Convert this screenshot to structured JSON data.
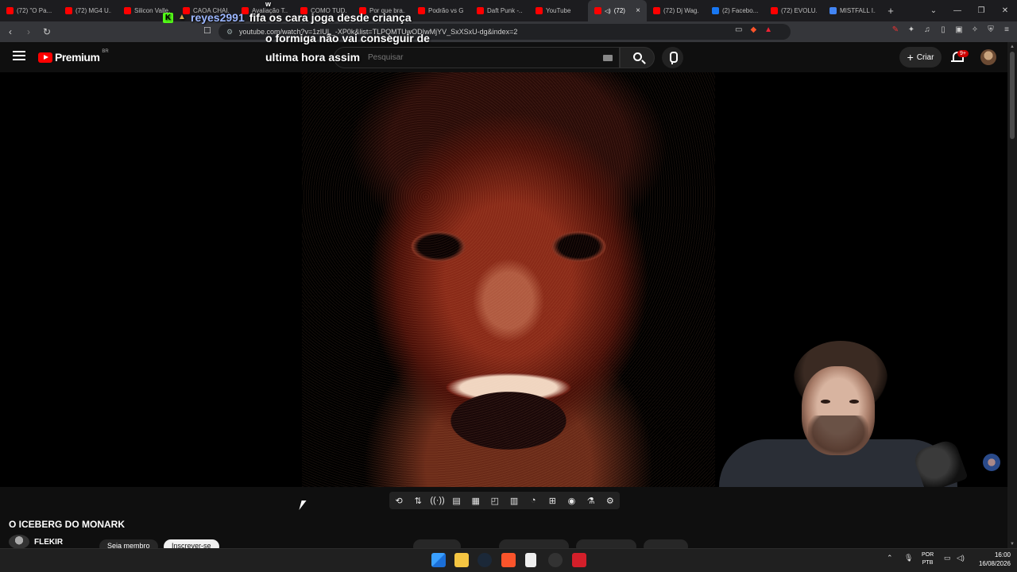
{
  "browser": {
    "tabs": [
      {
        "label": "(72) \"O Pa...",
        "color": "#ff0000"
      },
      {
        "label": "(72) MG4 U...",
        "color": "#ff0000"
      },
      {
        "label": "Silicon Valle...",
        "color": "#ff0000"
      },
      {
        "label": "CAOA CHAI...",
        "color": "#ff0000"
      },
      {
        "label": "Avaliação T...",
        "color": "#ff0000"
      },
      {
        "label": "COMO TUD...",
        "color": "#ff0000"
      },
      {
        "label": "Por que bra...",
        "color": "#ff0000"
      },
      {
        "label": "Podrão vs G...",
        "color": "#ff0000"
      },
      {
        "label": "Daft Punk -...",
        "color": "#ff0000"
      },
      {
        "label": "YouTube",
        "color": "#ff0000"
      },
      {
        "label": "(72)",
        "color": "#ff0000",
        "active": true
      },
      {
        "label": "(72) Dj Wag...",
        "color": "#ff0000"
      },
      {
        "label": "(2) Facebo...",
        "color": "#1877f2"
      },
      {
        "label": "(72) EVOLU...",
        "color": "#ff0000"
      },
      {
        "label": "MISTFALL I...",
        "color": "#4285f4"
      }
    ],
    "new_tab": "+",
    "url": "youtube.com/watch?v=1zIUL_-XP0k&list=TLPQMTUwODIwMjYV_SxXSxU-dg&index=2"
  },
  "youtube": {
    "logo_word": "Premium",
    "logo_country": "BR",
    "search_placeholder": "Pesquisar",
    "create_label": "Criar",
    "notification_count": "9+"
  },
  "chat": {
    "username": "reyes2991",
    "message_line1": "fifa os cara joga desde criança",
    "message_line2": "o formiga não vai conseguir de",
    "message_line3": "ultima hora assim",
    "k_badge": "K",
    "w_letter": "w"
  },
  "video": {
    "title": "O ICEBERG DO MONARK",
    "channel": "FLEKIR",
    "join_label": "Seja membro",
    "subscribe_label": "Inscrever-se"
  },
  "taskbar": {
    "lang_top": "POR",
    "lang_bottom": "PTB",
    "time": "16:00",
    "date": "16/08/2026"
  },
  "colors": {
    "youtube_red": "#ff0000",
    "chat_username": "#9bb6ff",
    "kick_green": "#53fc18"
  }
}
